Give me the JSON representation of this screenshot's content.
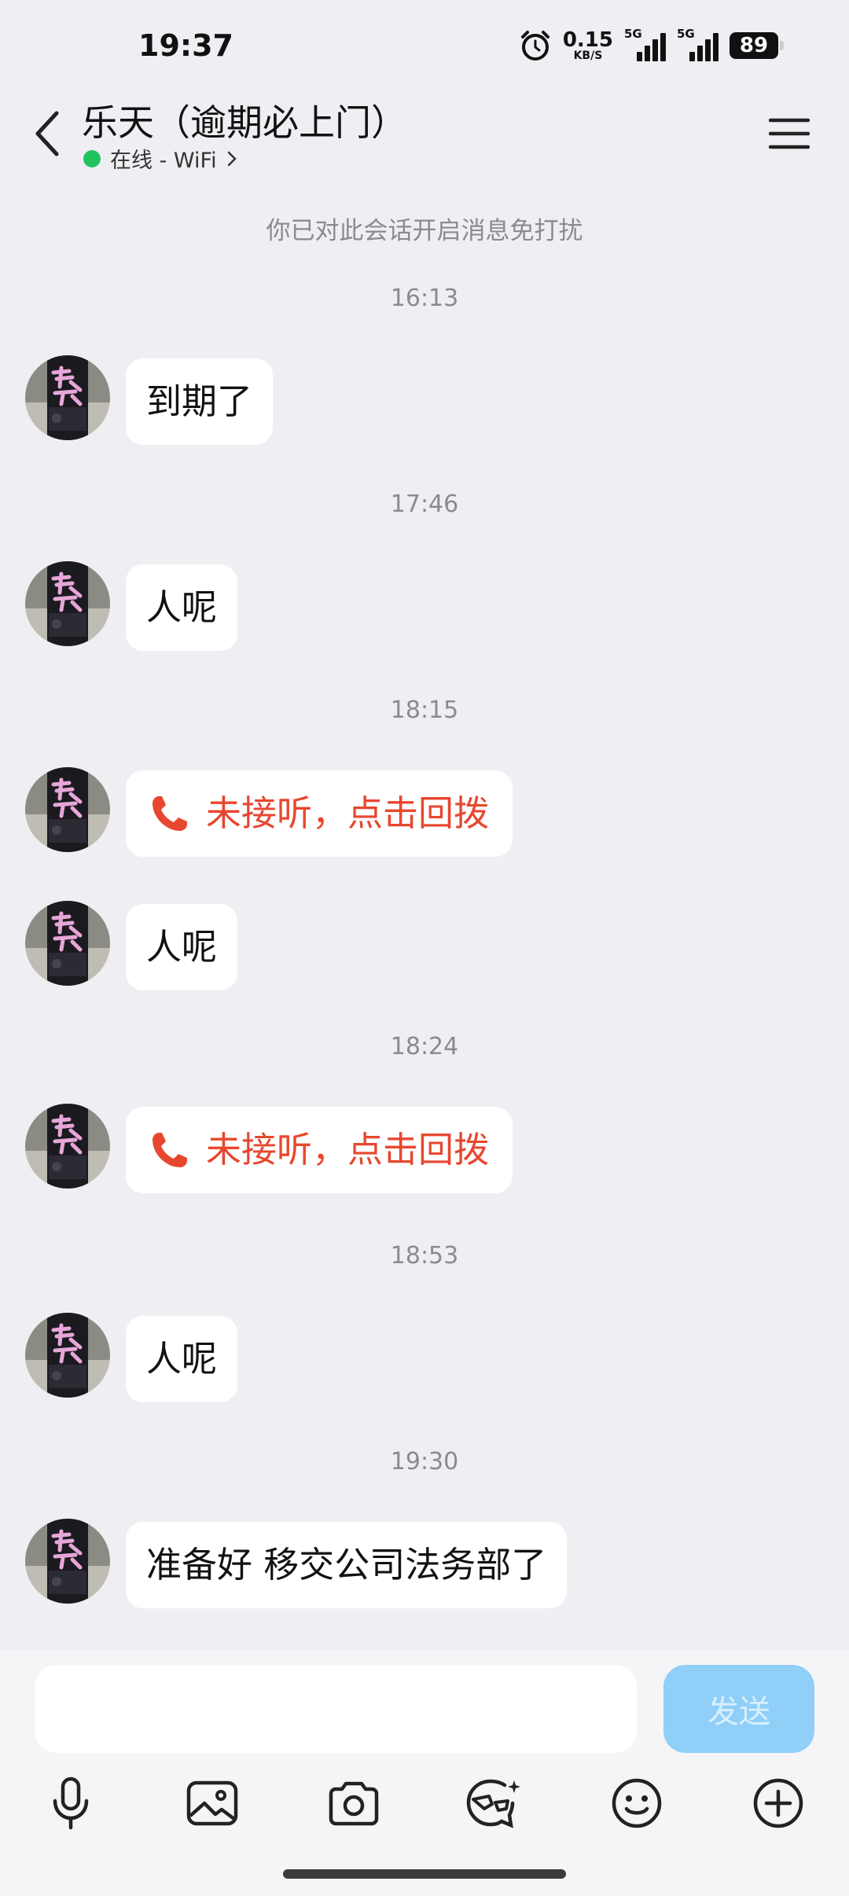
{
  "status_bar": {
    "time": "19:37",
    "net_speed_value": "0.15",
    "net_speed_unit": "KB/S",
    "sim1_tag": "5G",
    "sim2_tag": "5G",
    "battery": "89",
    "icons": [
      "alarm-icon",
      "signal-icon",
      "battery-icon"
    ]
  },
  "header": {
    "title": "乐天（逾期必上门）",
    "presence": "在线 - WiFi",
    "presence_color": "#22c35f",
    "icons": [
      "back-arrow-icon",
      "menu-icon",
      "chevron-right-icon"
    ]
  },
  "chat": {
    "mute_notice": "你已对此会话开启消息免打扰",
    "items": [
      {
        "kind": "time",
        "text": "16:13"
      },
      {
        "kind": "text",
        "text": "到期了"
      },
      {
        "kind": "time",
        "text": "17:46"
      },
      {
        "kind": "text",
        "text": "人呢"
      },
      {
        "kind": "time",
        "text": "18:15"
      },
      {
        "kind": "call",
        "text": "未接听，点击回拨"
      },
      {
        "kind": "text",
        "text": "人呢"
      },
      {
        "kind": "time",
        "text": "18:24"
      },
      {
        "kind": "call",
        "text": "未接听，点击回拨"
      },
      {
        "kind": "time",
        "text": "18:53"
      },
      {
        "kind": "text",
        "text": "人呢"
      },
      {
        "kind": "time",
        "text": "19:30"
      },
      {
        "kind": "text",
        "text": "准备好 移交公司法务部了"
      }
    ],
    "missed_call_color": "#e8472f"
  },
  "input": {
    "value": "",
    "placeholder": "",
    "send_label": "发送",
    "send_color": "#8fcff8"
  },
  "toolbar": {
    "icons": [
      "microphone-icon",
      "image-icon",
      "camera-icon",
      "sticker-icon",
      "emoji-icon",
      "plus-icon"
    ]
  }
}
